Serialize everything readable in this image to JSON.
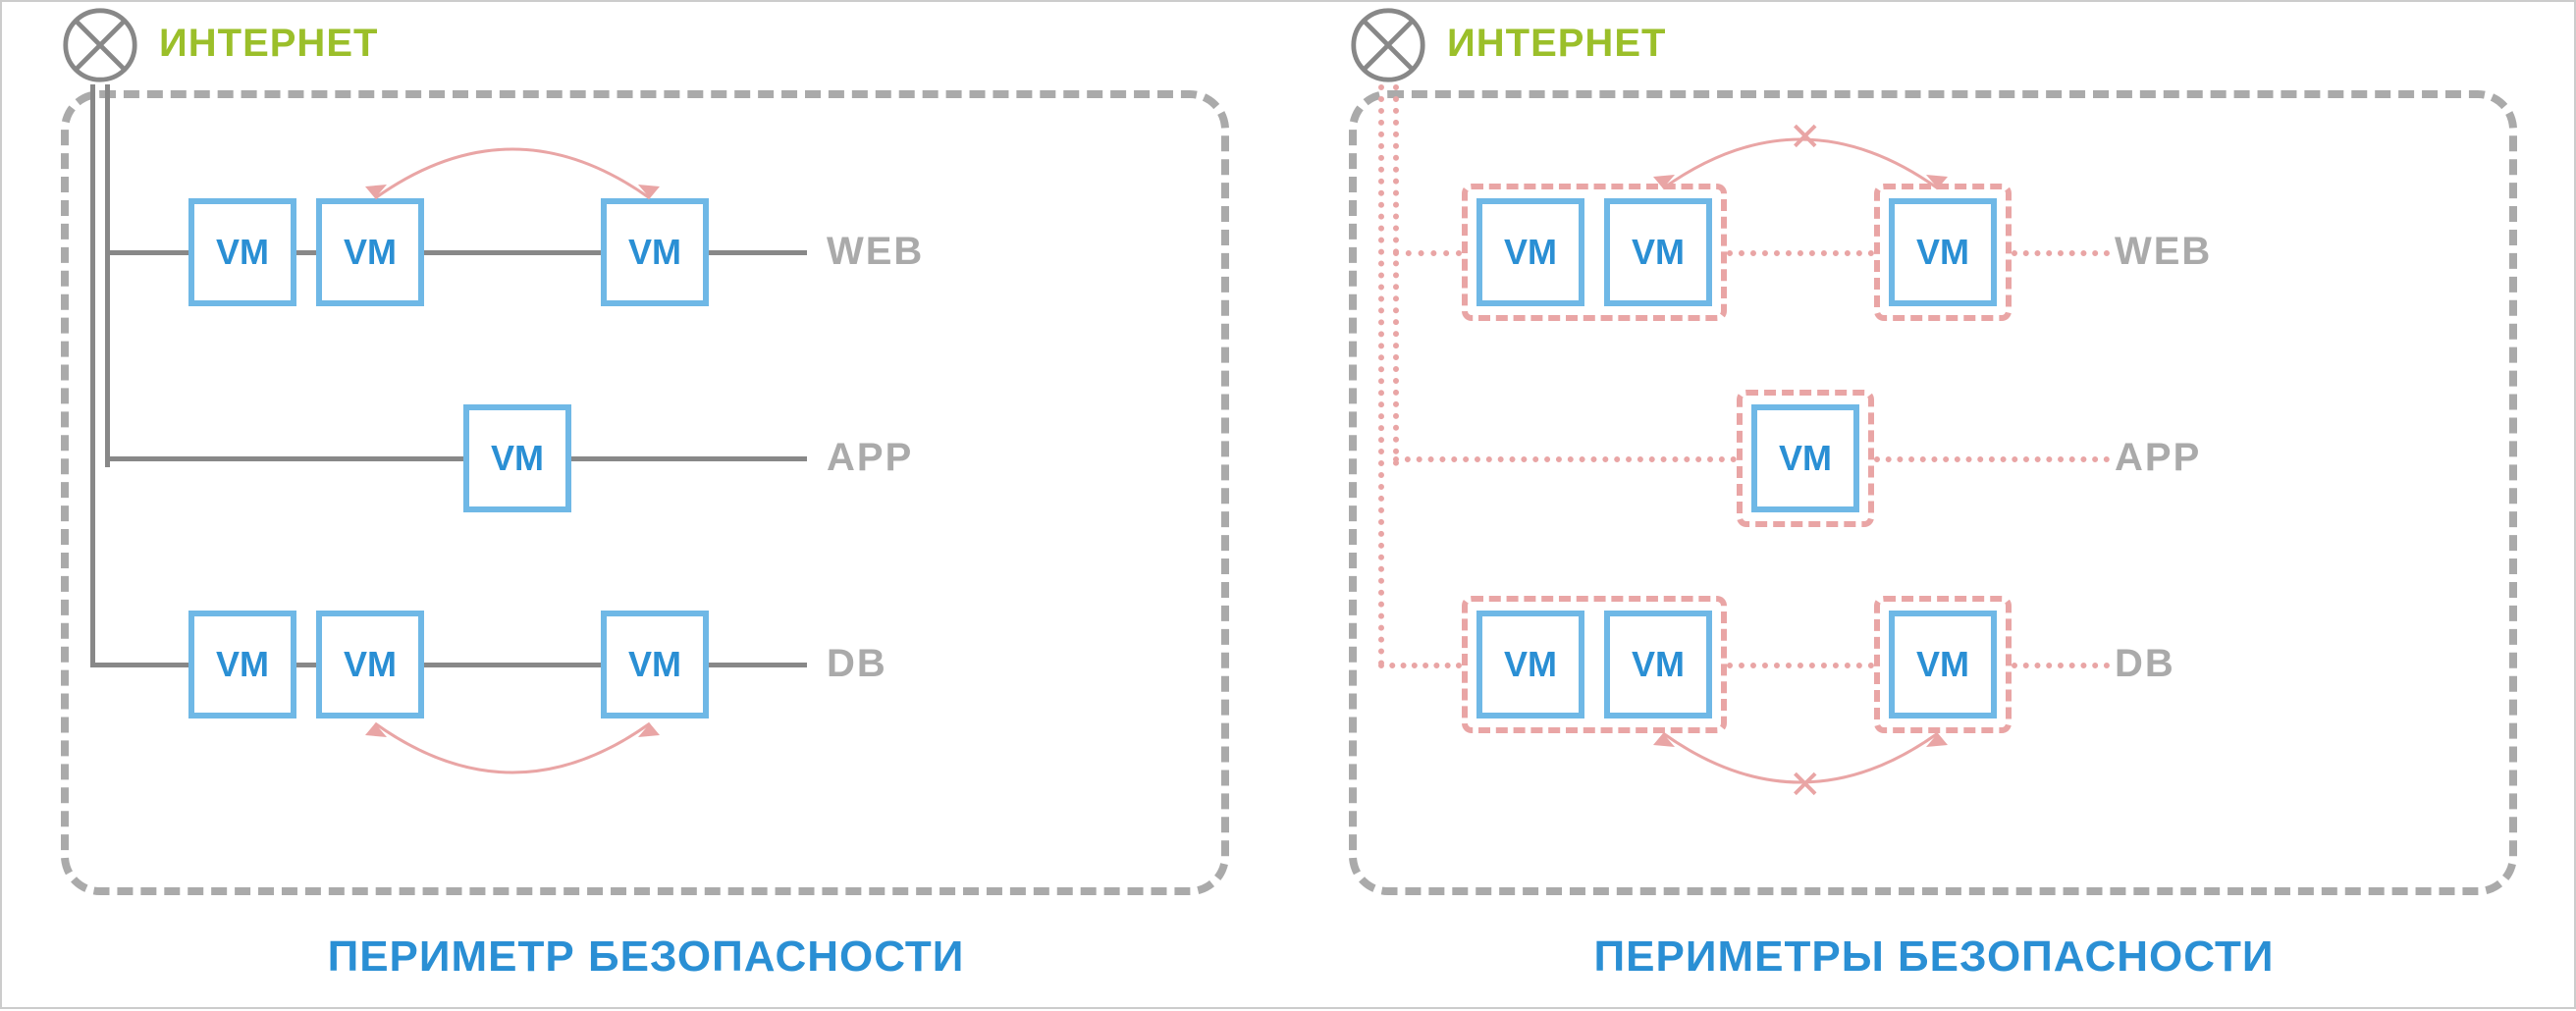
{
  "internet_label": "ИНТЕРНЕТ",
  "vm_label": "VM",
  "rows": {
    "web": "WEB",
    "app": "APP",
    "db": "DB"
  },
  "left_caption": "ПЕРИМЕТР БЕЗОПАСНОСТИ",
  "right_caption": "ПЕРИМЕТРЫ БЕЗОПАСНОСТИ",
  "colors": {
    "vm_border": "#6fb8e6",
    "vm_text": "#2a8fd4",
    "internet": "#9bbf2a",
    "perimeter": "#aaaaaa",
    "micro": "#e9a5a5",
    "conn_solid": "#888888"
  }
}
